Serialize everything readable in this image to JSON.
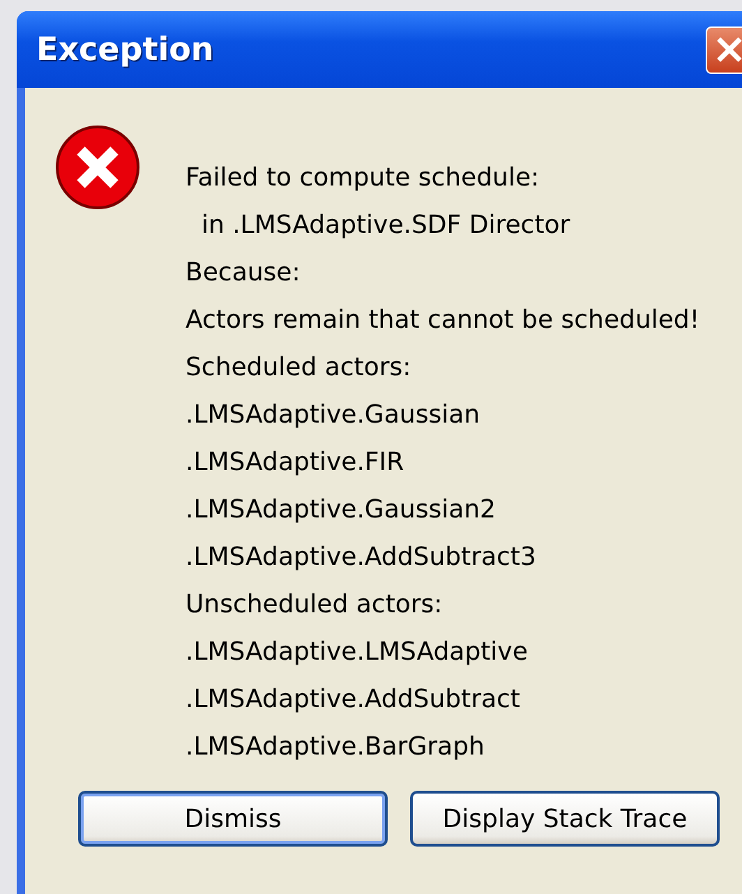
{
  "window": {
    "title": "Exception",
    "close_button": "×"
  },
  "message_lines": [
    "Failed to compute schedule:",
    "  in .LMSAdaptive.SDF Director",
    "Because:",
    "Actors remain that cannot be scheduled!",
    "Scheduled actors:",
    ".LMSAdaptive.Gaussian",
    ".LMSAdaptive.FIR",
    ".LMSAdaptive.Gaussian2",
    ".LMSAdaptive.AddSubtract3",
    "Unscheduled actors:",
    ".LMSAdaptive.LMSAdaptive",
    ".LMSAdaptive.AddSubtract",
    ".LMSAdaptive.BarGraph"
  ],
  "buttons": [
    {
      "label": "Dismiss",
      "default": true
    },
    {
      "label": "Display Stack Trace",
      "default": false
    }
  ]
}
